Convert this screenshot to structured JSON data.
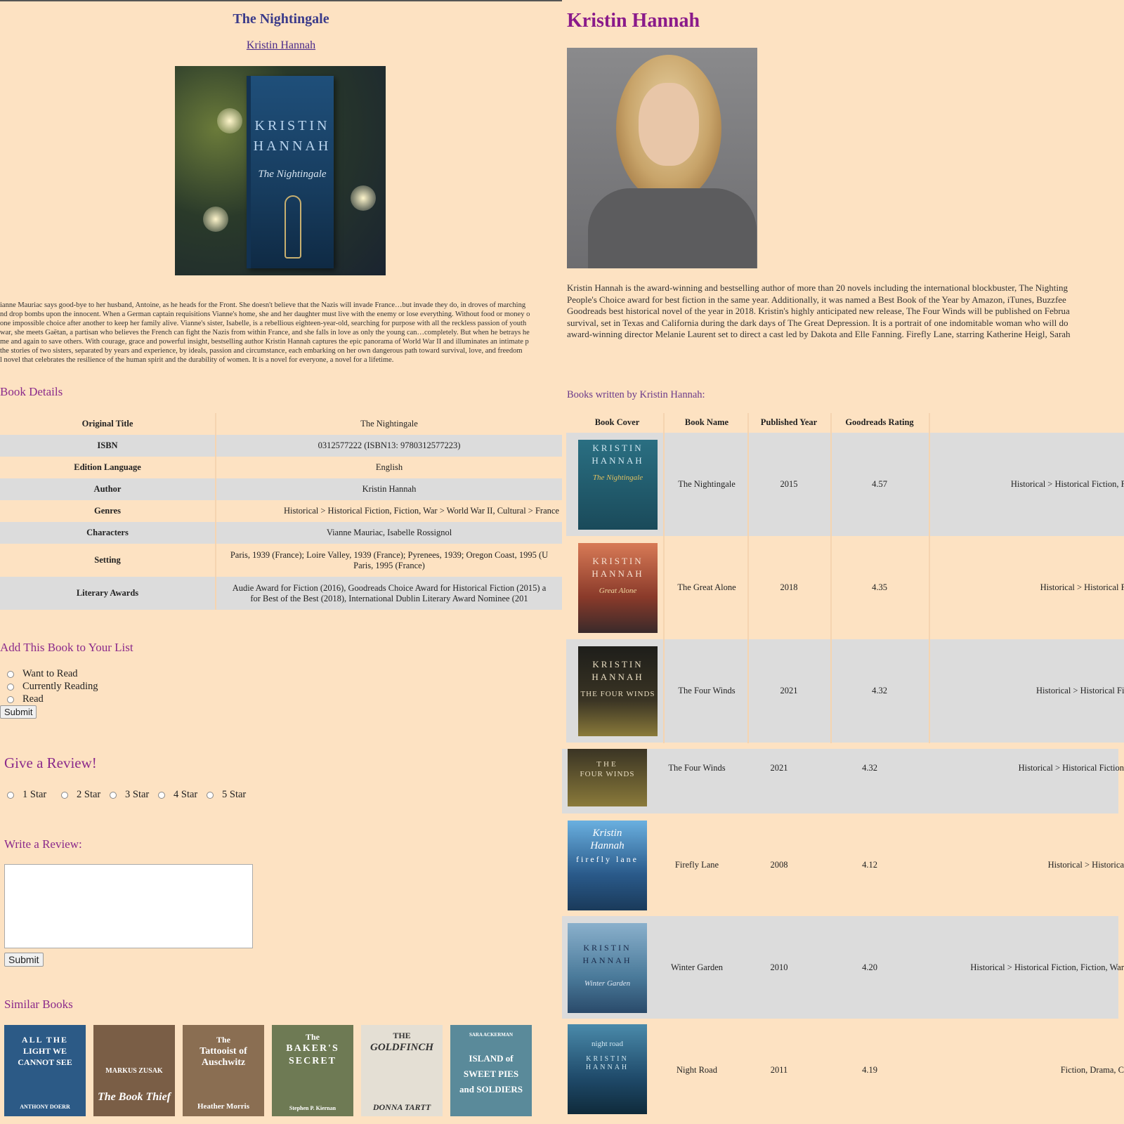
{
  "book": {
    "title": "The Nightingale",
    "author": "Kristin Hannah",
    "cover_text": {
      "author_line1": "KRISTIN",
      "author_line2": "HANNAH",
      "title": "The Nightingale"
    },
    "synopsis": [
      "ianne Mauriac says good-bye to her husband, Antoine, as he heads for the Front. She doesn't believe that the Nazis will invade France…but invade they do, in droves of marching",
      "nd drop bombs upon the innocent. When a German captain requisitions Vianne's home, she and her daughter must live with the enemy or lose everything. Without food or money o",
      "one impossible choice after another to keep her family alive. Vianne's sister, Isabelle, is a rebellious eighteen-year-old, searching for purpose with all the reckless passion of youth",
      "war, she meets Gaëtan, a partisan who believes the French can fight the Nazis from within France, and she falls in love as only the young can…completely. But when he betrays he",
      "me and again to save others. With courage, grace and powerful insight, bestselling author Kristin Hannah captures the epic panorama of World War II and illuminates an intimate p",
      "the stories of two sisters, separated by years and experience, by ideals, passion and circumstance, each embarking on her own dangerous path toward survival, love, and freedom",
      "l novel that celebrates the resilience of the human spirit and the durability of women. It is a novel for everyone, a novel for a lifetime."
    ]
  },
  "details": {
    "heading": "Book Details",
    "rows": [
      {
        "k": "Original Title",
        "v": "The Nightingale"
      },
      {
        "k": "ISBN",
        "v": "0312577222 (ISBN13: 9780312577223)"
      },
      {
        "k": "Edition Language",
        "v": "English"
      },
      {
        "k": "Author",
        "v": "Kristin Hannah"
      },
      {
        "k": "Genres",
        "v": "Historical > Historical Fiction, Fiction, War > World War II, Cultural > France"
      },
      {
        "k": "Characters",
        "v": "Vianne Mauriac, Isabelle Rossignol"
      },
      {
        "k": "Setting",
        "v": "Paris, 1939 (France); Loire Valley, 1939 (France); Pyrenees, 1939; Oregon Coast, 1995 (U",
        "v2": "Paris, 1995 (France)"
      },
      {
        "k": "Literary Awards",
        "v": "Audie Award for Fiction (2016), Goodreads Choice Award for Historical Fiction (2015) a",
        "v2": "for Best of the Best (2018), International Dublin Literary Award Nominee (201"
      }
    ]
  },
  "list": {
    "heading": "Add This Book to Your List",
    "options": [
      "Want to Read",
      "Currently Reading",
      "Read"
    ],
    "submit": "Submit"
  },
  "review": {
    "heading": "Give a Review!",
    "stars": [
      "1 Star",
      "2 Star",
      "3 Star",
      "4 Star",
      "5 Star"
    ],
    "write_label": "Write a Review:",
    "submit": "Submit"
  },
  "similar": {
    "heading": "Similar Books",
    "books": [
      {
        "line1": "ALL THE",
        "line2": "LIGHT WE",
        "line3": "CANNOT SEE",
        "author": "ANTHONY DOERR",
        "color": "#2c5a86"
      },
      {
        "line1": "",
        "line2": "MARKUS ZUSAK",
        "line3": "The Book Thief",
        "author": "",
        "color": "#7a5e46"
      },
      {
        "line1": "The",
        "line2": "Tattooist of",
        "line3": "Auschwitz",
        "author": "Heather Morris",
        "color": "#8a6e52"
      },
      {
        "line1": "The",
        "line2": "BAKER'S",
        "line3": "SECRET",
        "author": "Stephen P. Kiernan",
        "color": "#6e7a54"
      },
      {
        "line1": "THE",
        "line2": "GOLDFINCH",
        "line3": "",
        "author": "DONNA TARTT",
        "color": "#e4dfd4"
      },
      {
        "line1": "SARA ACKERMAN",
        "line2": "ISLAND of",
        "line3": "SWEET PIES",
        "author": "and SOLDIERS",
        "color": "#5a8a9a"
      }
    ]
  },
  "author": {
    "name": "Kristin Hannah",
    "bio": [
      "Kristin Hannah is the award-winning and bestselling author of more than 20 novels including the international blockbuster, The Nighting",
      "People's Choice award for best fiction in the same year. Additionally, it was named a Best Book of the Year by Amazon, iTunes, Buzzfee",
      "Goodreads best historical novel of the year in 2018. Kristin's highly anticipated new release, The Four Winds will be published on Februa",
      "survival, set in Texas and California during the dark days of The Great Depression. It is a portrait of one indomitable woman who will do",
      "award-winning director Melanie Laurent set to direct a cast led by Dakota and Elle Fanning. Firefly Lane, starring Katherine Heigl, Sarah"
    ],
    "books_heading": "Books written by Kristin Hannah:",
    "columns": [
      "Book Cover",
      "Book Name",
      "Published Year",
      "Goodreads Rating"
    ],
    "books": [
      {
        "name": "The Nightingale",
        "year": "2015",
        "rating": "4.57",
        "genres": "Historical > Historical Fiction, Fi",
        "cover1": "KRISTIN",
        "cover2": "HANNAH",
        "cover3": "The Nightingale",
        "color": "#2a6f82"
      },
      {
        "name": "The Great Alone",
        "year": "2018",
        "rating": "4.35",
        "genres": "Historical > Historical Fi",
        "cover1": "KRISTIN",
        "cover2": "HANNAH",
        "cover3": "Great Alone",
        "color": "#c26a4a"
      },
      {
        "name": "The Four Winds",
        "year": "2021",
        "rating": "4.32",
        "genres": "Historical > Historical Fic",
        "cover1": "KRISTIN",
        "cover2": "HANNAH",
        "cover3": "THE FOUR WINDS",
        "color": "#2a2a24"
      },
      {
        "name": "The Four Winds",
        "year": "2021",
        "rating": "4.32",
        "genres": "Historical > Historical Fiction",
        "cover1": "",
        "cover2": "THE",
        "cover3": "FOUR WINDS",
        "color": "#2a2a24"
      },
      {
        "name": "Firefly Lane",
        "year": "2008",
        "rating": "4.12",
        "genres": "Historical > Historica",
        "cover1": "Kristin",
        "cover2": "Hannah",
        "cover3": "firefly lane",
        "color": "#3a6a9a"
      },
      {
        "name": "Winter Garden",
        "year": "2010",
        "rating": "4.20",
        "genres": "Historical > Historical Fiction, Fiction, War",
        "cover1": "KRISTIN",
        "cover2": "HANNAH",
        "cover3": "Winter Garden",
        "color": "#4a7a9a"
      },
      {
        "name": "Night Road",
        "year": "2011",
        "rating": "4.19",
        "genres": "Fiction, Drama, C",
        "cover1": "night road",
        "cover2": "KRISTIN",
        "cover3": "HANNAH",
        "color": "#1f4a6a"
      }
    ]
  },
  "colors": {
    "background": "#fde2c2",
    "accent": "#8b2a8b",
    "row_alt": "#dcdcdc",
    "link": "#4a2a8a"
  }
}
